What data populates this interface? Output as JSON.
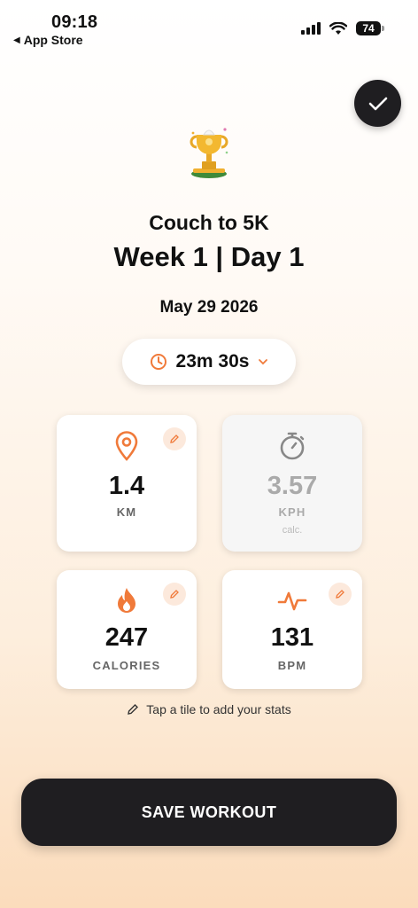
{
  "status_bar": {
    "time": "09:18",
    "back_app": "App Store",
    "battery": "74"
  },
  "workout": {
    "program": "Couch to 5K",
    "week_day": "Week 1 | Day 1",
    "date": "May 29 2026",
    "duration": "23m 30s"
  },
  "tiles": {
    "distance": {
      "value": "1.4",
      "unit": "KM"
    },
    "speed": {
      "value": "3.57",
      "unit": "KPH",
      "sub": "calc."
    },
    "calories": {
      "value": "247",
      "unit": "CALORIES"
    },
    "heart_rate": {
      "value": "131",
      "unit": "BPM"
    }
  },
  "hint": "Tap a tile to add your stats",
  "save_button": "SAVE WORKOUT",
  "colors": {
    "accent": "#f07a3a",
    "dark": "#1f1e21",
    "edit_bg": "#fce9dc"
  },
  "icons": [
    "check-icon",
    "trophy-icon",
    "clock-icon",
    "chevron-down-icon",
    "location-pin-icon",
    "stopwatch-icon",
    "flame-icon",
    "pulse-icon",
    "pencil-icon"
  ]
}
